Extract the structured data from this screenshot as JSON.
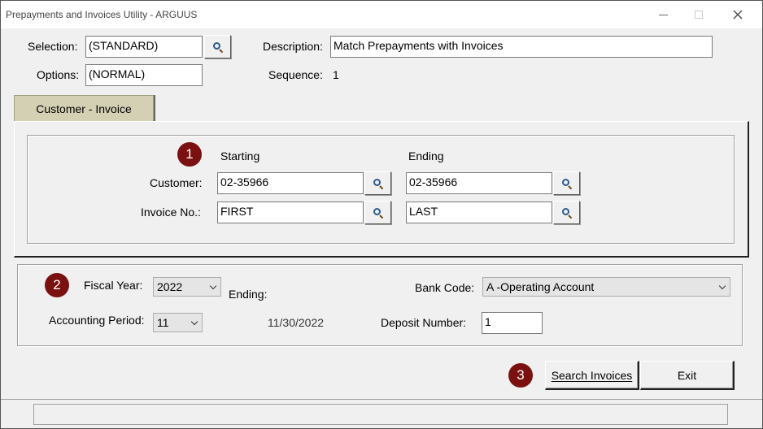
{
  "window": {
    "title": "Prepayments and Invoices Utility - ARGUUS"
  },
  "header": {
    "selection_label": "Selection:",
    "selection_value": "(STANDARD)",
    "options_label": "Options:",
    "options_value": "(NORMAL)",
    "description_label": "Description:",
    "description_value": "Match Prepayments with Invoices",
    "sequence_label": "Sequence:",
    "sequence_value": "1"
  },
  "tabs": [
    {
      "label": "Customer - Invoice"
    }
  ],
  "range": {
    "badge": "1",
    "starting_header": "Starting",
    "ending_header": "Ending",
    "customer_label": "Customer:",
    "customer_start": "02-35966",
    "customer_end": "02-35966",
    "invoice_label": "Invoice No.:",
    "invoice_start": "FIRST",
    "invoice_end": "LAST"
  },
  "period": {
    "badge": "2",
    "fiscal_year_label": "Fiscal Year:",
    "fiscal_year_value": "2022",
    "ending_label": "Ending:",
    "accounting_period_label": "Accounting Period:",
    "accounting_period_value": "11",
    "ending_date": "11/30/2022",
    "bank_code_label": "Bank Code:",
    "bank_code_value": "A  -Operating Account",
    "deposit_number_label": "Deposit Number:",
    "deposit_number_value": "1"
  },
  "actions": {
    "badge": "3",
    "search_label": "Search Invoices",
    "exit_label": "Exit"
  },
  "colors": {
    "badge": "#7b1010",
    "tab": "#d4d0b4",
    "window": "#f0f0f0"
  }
}
